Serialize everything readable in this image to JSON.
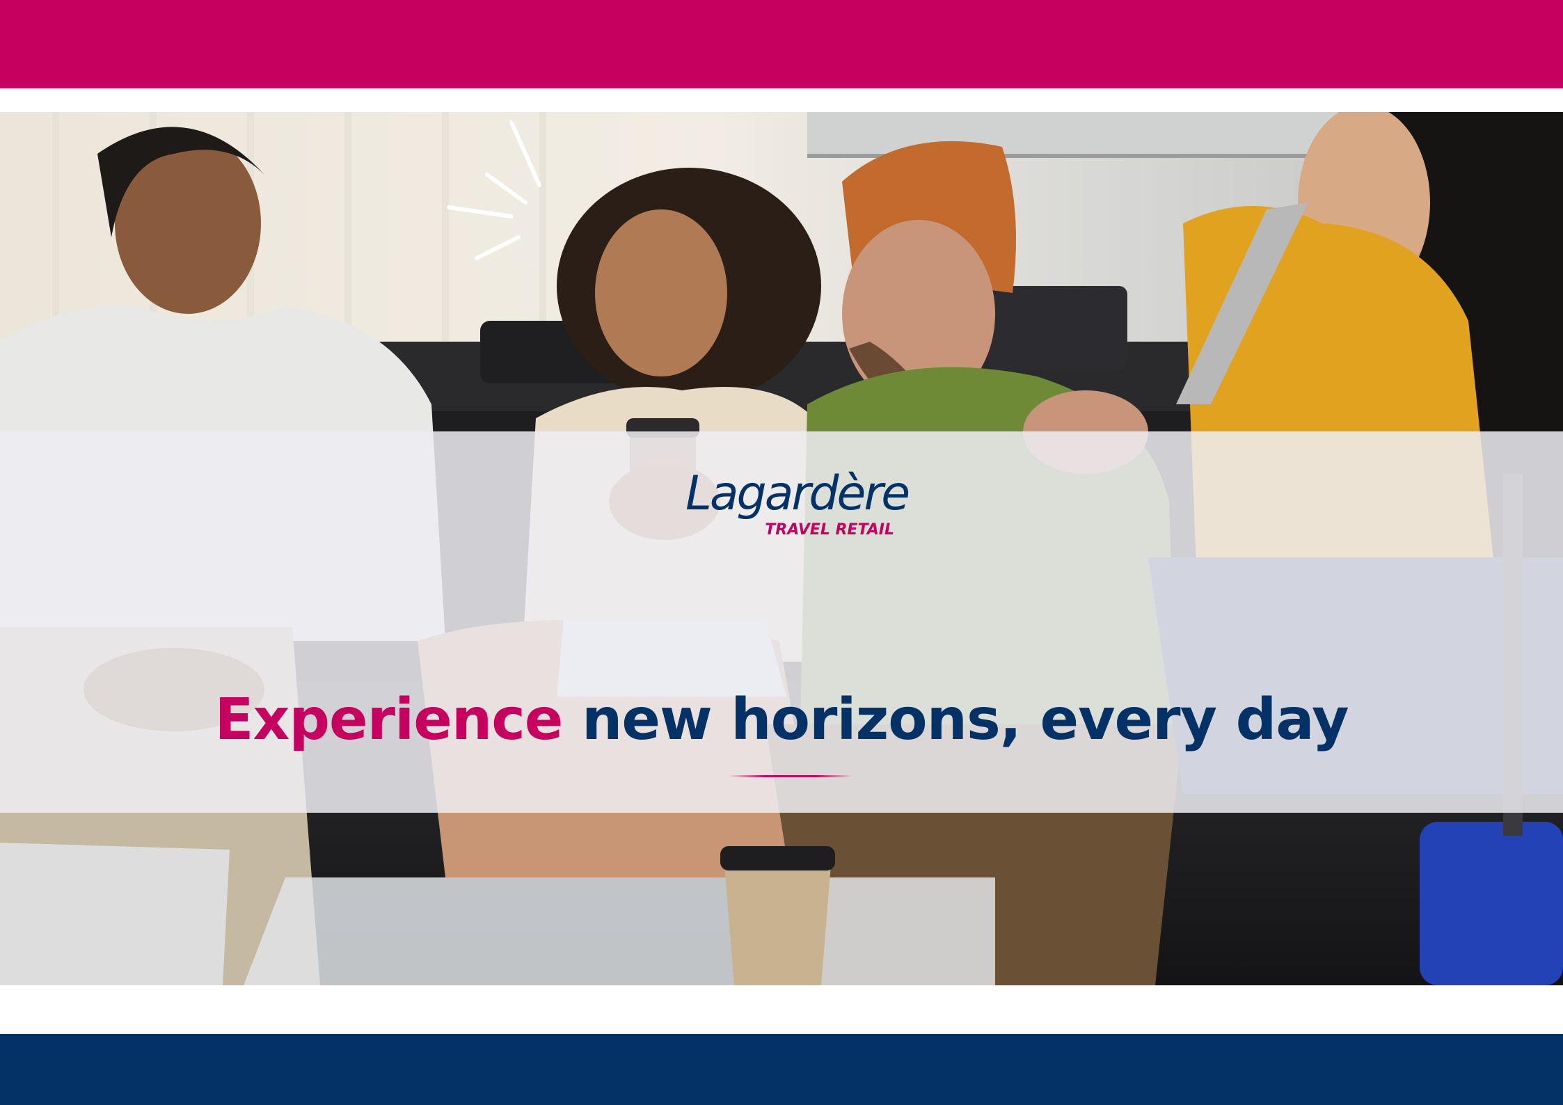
{
  "colors": {
    "brand_magenta": "#c5005e",
    "brand_navy": "#053266",
    "overlay": "#eeeef2"
  },
  "photo": {
    "icon": "lounge-people-photo",
    "subject": "Four travellers laughing together in an airport lounge"
  },
  "logo": {
    "wordmark": "Lagardère",
    "subline": "TRAVEL RETAIL"
  },
  "headline": {
    "highlight": "Experience",
    "rest": "new horizons, every day"
  }
}
